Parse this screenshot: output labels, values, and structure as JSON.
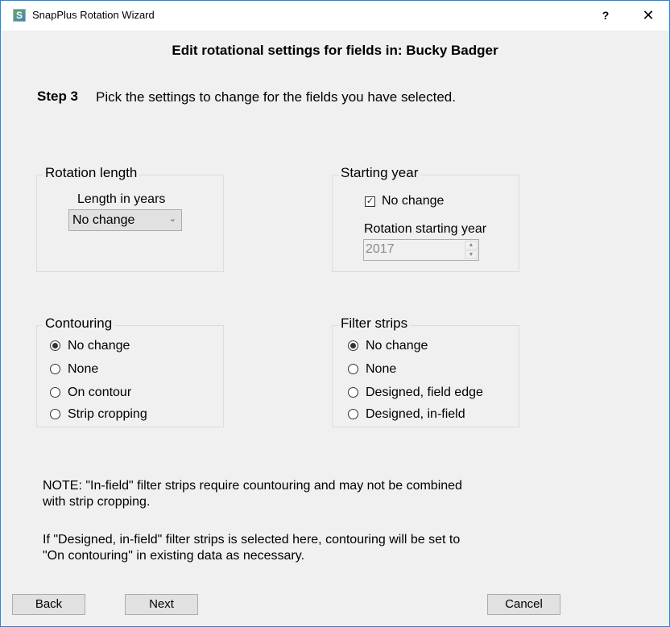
{
  "window": {
    "title": "SnapPlus Rotation Wizard",
    "help_label": "?",
    "close_label": "✕",
    "app_icon": "snapplus-logo-icon"
  },
  "header": {
    "title": "Edit rotational settings for fields in: Bucky Badger"
  },
  "step": {
    "label": "Step 3",
    "description": "Pick the settings to change for the fields you have selected."
  },
  "rotation_length": {
    "legend": "Rotation length",
    "field_label": "Length in years",
    "selected": "No change",
    "dropdown_icon": "chevron-down-icon"
  },
  "starting_year": {
    "legend": "Starting year",
    "no_change_label": "No change",
    "no_change_checked": true,
    "field_label": "Rotation starting year",
    "value": "2017",
    "disabled": true
  },
  "contouring": {
    "legend": "Contouring",
    "options": [
      {
        "label": "No change",
        "checked": true
      },
      {
        "label": "None",
        "checked": false
      },
      {
        "label": "On contour",
        "checked": false
      },
      {
        "label": "Strip cropping",
        "checked": false
      }
    ]
  },
  "filter_strips": {
    "legend": "Filter strips",
    "options": [
      {
        "label": "No change",
        "checked": true
      },
      {
        "label": "None",
        "checked": false
      },
      {
        "label": "Designed, field edge",
        "checked": false
      },
      {
        "label": "Designed, in-field",
        "checked": false
      }
    ]
  },
  "notes": {
    "note1_line1": "NOTE: \"In-field\" filter strips require countouring and may not be combined",
    "note1_line2": "with strip cropping.",
    "note2_line1": "If \"Designed, in-field\" filter strips is selected here, contouring will be set to",
    "note2_line2": "\"On contouring\" in existing data as necessary."
  },
  "buttons": {
    "back": "Back",
    "next": "Next",
    "cancel": "Cancel"
  }
}
